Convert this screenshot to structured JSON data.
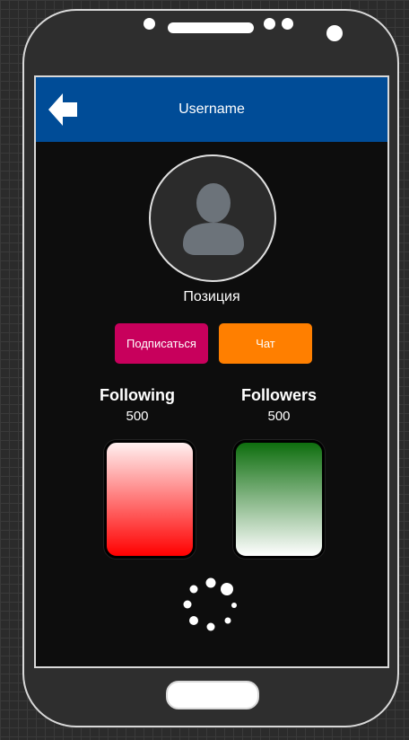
{
  "header": {
    "title": "Username",
    "color": "#004c97"
  },
  "profile": {
    "position": "Позиция"
  },
  "actions": {
    "subscribe_label": "Подписаться",
    "chat_label": "Чат",
    "subscribe_color": "#c8005c",
    "chat_color": "#ff7f00"
  },
  "stats": {
    "following_label": "Following",
    "following_value": "500",
    "followers_label": "Followers",
    "followers_value": "500"
  },
  "icons": {
    "back": "back-arrow-icon",
    "avatar": "user-silhouette-icon",
    "loading": "loading-spinner-icon"
  }
}
